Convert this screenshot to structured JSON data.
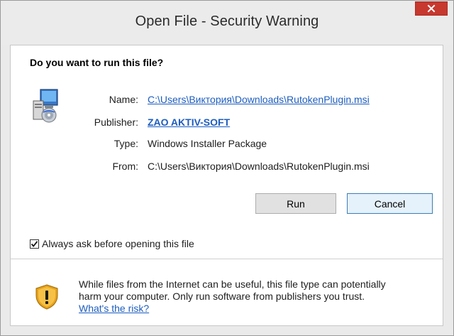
{
  "window": {
    "title": "Open File - Security Warning",
    "close_icon": "close-icon"
  },
  "dialog": {
    "question": "Do you want to run this file?",
    "file_icon": "installer-package-icon",
    "fields": {
      "name_label": "Name:",
      "name_value": "C:\\Users\\Виктория\\Downloads\\RutokenPlugin.msi",
      "publisher_label": "Publisher:",
      "publisher_value": "ZAO AKTIV-SOFT",
      "type_label": "Type:",
      "type_value": "Windows Installer Package",
      "from_label": "From:",
      "from_value": "C:\\Users\\Виктория\\Downloads\\RutokenPlugin.msi"
    },
    "buttons": {
      "run": "Run",
      "cancel": "Cancel"
    },
    "always_ask": {
      "label": "Always ask before opening this file",
      "checked": true
    },
    "warning": {
      "icon": "shield-warning-icon",
      "line1": "While files from the Internet can be useful, this file type can potentially",
      "line2": "harm your computer. Only run software from publishers you trust.",
      "link": "What's the risk?"
    }
  },
  "colors": {
    "link": "#1d5dbf",
    "close_button": "#c7382f",
    "window_bg": "#eaeaea",
    "client_bg": "#ffffff"
  }
}
